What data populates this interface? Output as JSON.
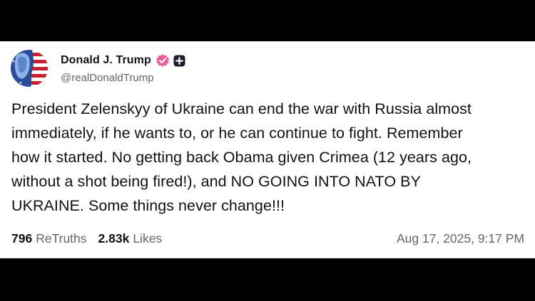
{
  "post": {
    "author": {
      "display_name": "Donald J. Trump",
      "handle": "@realDonaldTrump",
      "verified_icon": "verified-badge-icon",
      "plus_icon": "plus-badge-icon",
      "verified_color": "#ec5d9b"
    },
    "text_lines": [
      "President Zelenskyy of Ukraine can end the war with Russia almost",
      "immediately, if he wants to, or he can continue to fight. Remember",
      "how it started. No getting back Obama given Crimea (12 years ago,",
      "without a shot being fired!), and NO GOING INTO NATO BY",
      "UKRAINE. Some things never change!!!"
    ],
    "stats": {
      "retruths_count": "796",
      "retruths_label": "ReTruths",
      "likes_count": "2.83k",
      "likes_label": "Likes"
    },
    "timestamp": "Aug 17, 2025, 9:17 PM"
  }
}
